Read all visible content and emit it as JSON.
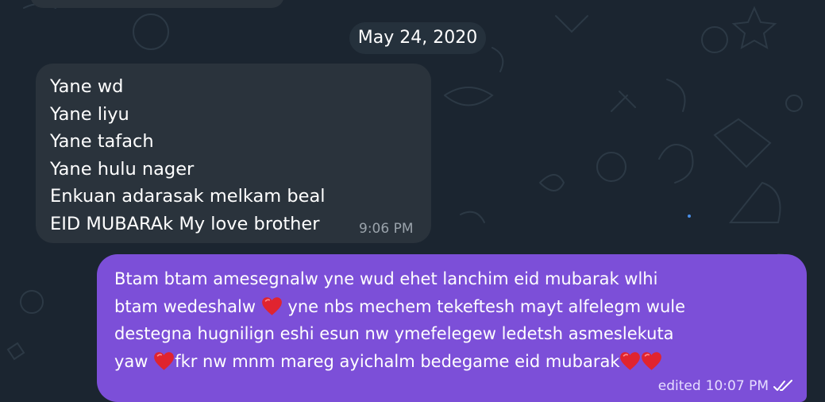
{
  "date_separator": "May 24, 2020",
  "incoming_message": {
    "lines": [
      "Yane wd",
      "Yane liyu",
      "Yane tafach",
      "Yane hulu nager",
      "Enkuan adarasak melkam beal",
      "EID MUBARAk My love brother"
    ],
    "time": "9:06 PM"
  },
  "outgoing_message": {
    "lines": [
      "Btam btam  amesegnalw yne wud ehet lanchim eid mubarak wlhi",
      "btam wedeshalw",
      "yne nbs mechem tekeftesh mayt alfelegm  wule",
      "destegna hugnilign eshi esun nw ymefelegew ledetsh asmeslekuta",
      "yaw",
      "fkr nw mnm mareg ayichalm bedegame eid mubarak"
    ],
    "edited_label": "edited",
    "time": "10:07 PM",
    "status_icon": "double-check-icon"
  },
  "colors": {
    "background": "#1b2530",
    "incoming_bubble": "#2a333c",
    "outgoing_bubble": "#7c4fd8",
    "heart": "#e0242f"
  }
}
